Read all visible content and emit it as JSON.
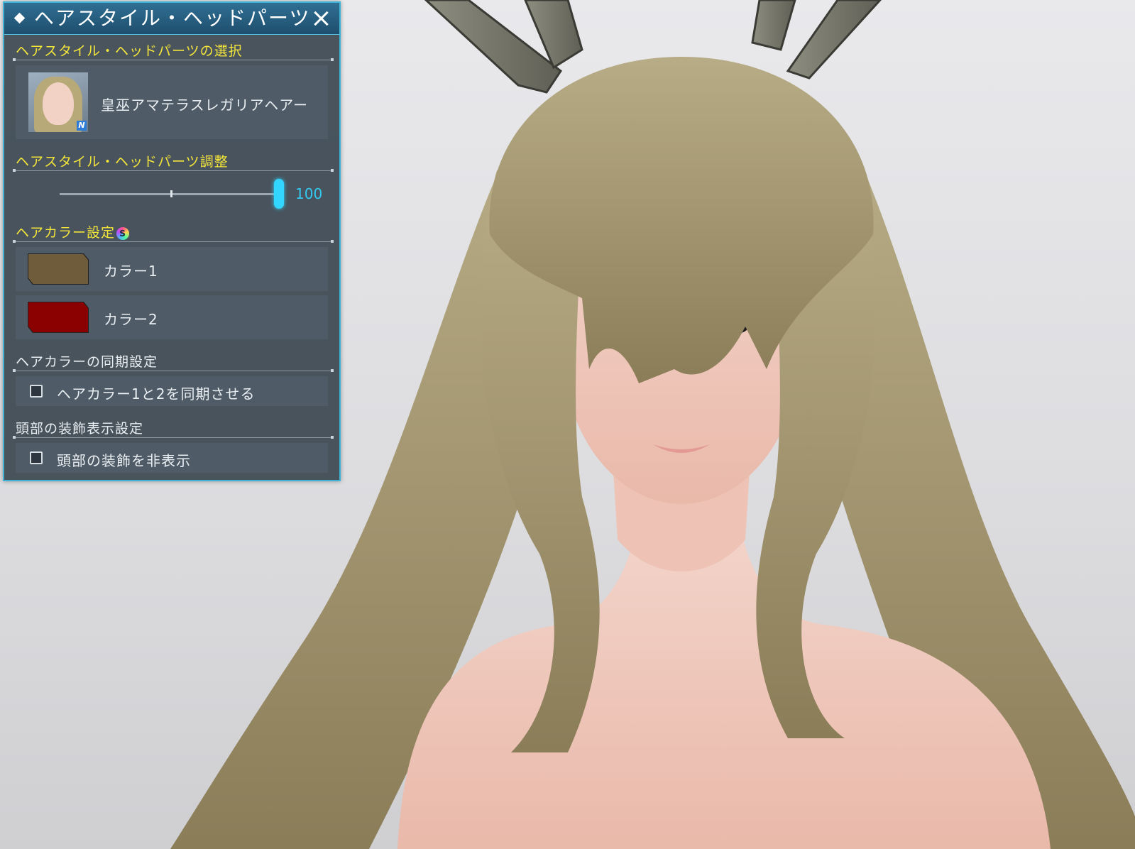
{
  "panel": {
    "title": "ヘアスタイル・ヘッドパーツ",
    "sections": {
      "selection": {
        "header": "ヘアスタイル・ヘッドパーツの選択",
        "item_name": "皇巫アマテラスレガリアヘアー",
        "badge": "N"
      },
      "adjust": {
        "header": "ヘアスタイル・ヘッドパーツ調整",
        "slider_value": "100",
        "slider_level": 100
      },
      "hair_color": {
        "header": "ヘアカラー設定",
        "sg_icon": "S",
        "colors": [
          {
            "label": "カラー1",
            "swatch": "#6e5c3a"
          },
          {
            "label": "カラー2",
            "swatch": "#8b0000"
          }
        ]
      },
      "sync": {
        "header": "ヘアカラーの同期設定",
        "checkbox_label": "ヘアカラー1と2を同期させる",
        "checked": false
      },
      "head_decor": {
        "header": "頭部の装飾表示設定",
        "checkbox_label": "頭部の装飾を非表示",
        "checked": false
      }
    }
  },
  "colors": {
    "accent": "#3fb3d6",
    "header_text": "#f4e53a",
    "slider": "#33d6ff"
  }
}
